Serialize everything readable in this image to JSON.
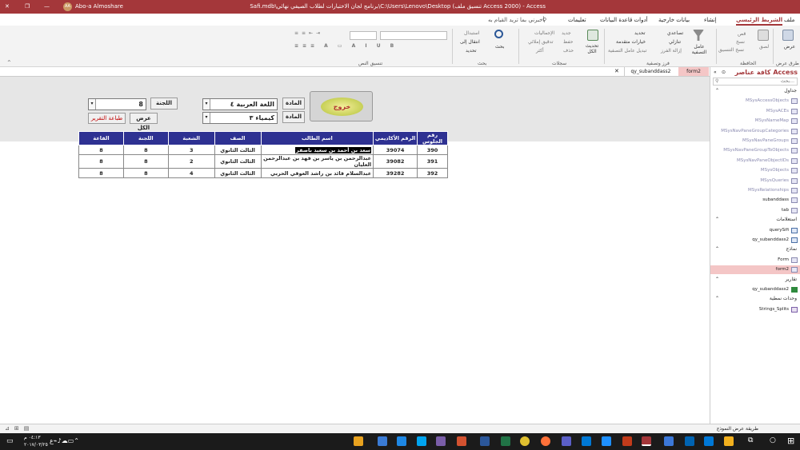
{
  "window": {
    "title": "Access - (Access 2000 تنسيق ملف) C:\\Users\\Lenovo\\Desktop\\برنامج لجان الاختبارات لطلاب الصيفي نهائي\\Safi.mdb : قاعدة بيانات - Safi",
    "user_name": "Abo-a Almoshare",
    "user_initials": "AA"
  },
  "menu": {
    "tabs": [
      "ملف",
      "الشريط الرئيسي",
      "إنشاء",
      "بيانات خارجية",
      "أدوات قاعدة البيانات",
      "تعليمات"
    ],
    "tell_me": "أخبرني بما تريد القيام به"
  },
  "ribbon": {
    "groups": [
      "طرق عرض",
      "الحافظة",
      "فرز وتصفية",
      "سجلات",
      "بحث",
      "تنسيق النص"
    ],
    "items": {
      "view": "عرض",
      "paste": "لصق",
      "cut": "قص",
      "copy": "نسخ",
      "format_painter": "نسخ التنسيق",
      "filter": "عامل التصفية",
      "ascending": "تصاعدي",
      "descending": "تنازلي",
      "remove_sort": "إزالة الفرز",
      "selection": "تحديد",
      "advanced": "خيارات متقدمة",
      "toggle_filter": "تبديل عامل التصفية",
      "refresh_all": "تحديث الكل",
      "new": "جديد",
      "save": "حفظ",
      "delete": "حذف",
      "totals": "الإجماليات",
      "spelling": "تدقيق إملائي",
      "more": "أكثر",
      "find": "بحث",
      "replace": "استبدال",
      "goto": "انتقال إلى",
      "select": "تحديد"
    }
  },
  "doc_tabs": [
    "form2",
    "qy_subanddass2"
  ],
  "form": {
    "exit_label": "خروج",
    "subject_label_1": "المادة",
    "subject_value_1": "اللغة العربية ٤",
    "subject_label_2": "المادة",
    "subject_value_2": "كيمياء ٣",
    "committee_label": "اللجنة",
    "committee_value": "8",
    "show_all": "عرض الكل",
    "print_report": "طباعة التقرير"
  },
  "table": {
    "headers": [
      "رقم الجلوس",
      "الرقم الأكاديمي",
      "اسم الطالب",
      "الصف",
      "الشعبة",
      "اللجنة",
      "القاعة"
    ],
    "rows": [
      [
        "390",
        "39074",
        "سعد بن أحمد بن سعيد باصقر",
        "الثالث الثانوي",
        "3",
        "8",
        "8"
      ],
      [
        "391",
        "39082",
        "عبدالرحمن بن ياسر بن فهد بن عبدالرحمن العليان",
        "الثالث الثانوي",
        "2",
        "8",
        "8"
      ],
      [
        "392",
        "39282",
        "عبدالسلام قائد بن راشد العوقي الحربي",
        "الثالث الثانوي",
        "4",
        "8",
        "8"
      ]
    ]
  },
  "nav": {
    "title": "كافة عناصر Access",
    "search_placeholder": "بحث...",
    "sections": [
      {
        "label": "جداول",
        "items": [
          "MSysAccessObjects",
          "MSysACEs",
          "MSysNameMap",
          "MSysNavPaneGroupCategories",
          "MSysNavPaneGroups",
          "MSysNavPaneGroupToObjects",
          "MSysNavPaneObjectIDs",
          "MSysObjects",
          "MSysQueries",
          "MSysRelationships",
          "subanddass",
          "tab"
        ]
      },
      {
        "label": "استعلامات",
        "items": [
          "querySifi",
          "qy_subanddass2"
        ]
      },
      {
        "label": "نماذج",
        "items": [
          "Form",
          "form2"
        ]
      },
      {
        "label": "تقارير",
        "items": [
          "qy_subanddass2"
        ]
      },
      {
        "label": "وحدات نمطية",
        "items": [
          "Strings_Splits"
        ]
      }
    ]
  },
  "status": {
    "left": "",
    "right": "طريقة عرض النموذج"
  },
  "taskbar": {
    "clock_time": "٠٤:١٣ م",
    "clock_date": "٢٠١٧/٠٣/٢٥"
  },
  "colors": {
    "title": "#a4373a",
    "table_header": "#2e3192",
    "print_text": "#c00000",
    "selected_nav": "#f4c6c6"
  }
}
